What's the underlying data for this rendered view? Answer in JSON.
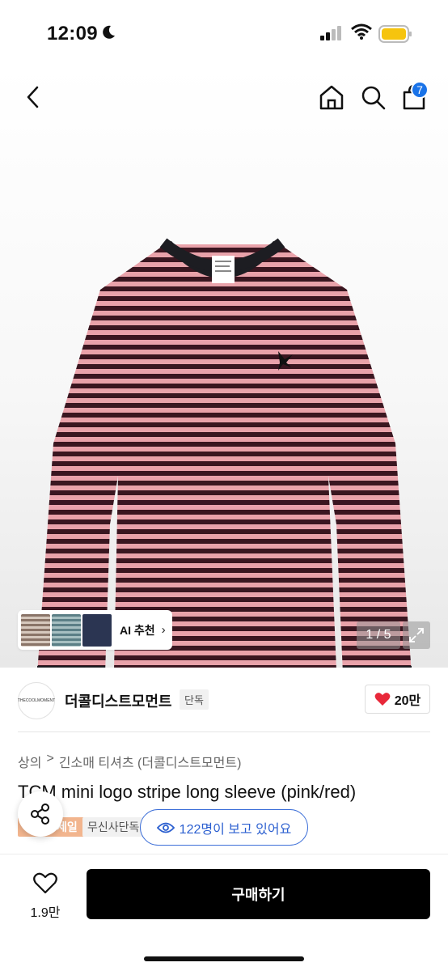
{
  "status": {
    "time": "12:09"
  },
  "nav": {
    "cart_count": "7"
  },
  "hero": {
    "ai_label": "AI 추천",
    "ai_chevron": "›",
    "pager": "1 / 5"
  },
  "brand": {
    "logo_text": "THECOOLMOMENT",
    "name": "더콜디스트모먼트",
    "tag": "단독",
    "likes": "20만"
  },
  "breadcrumb": [
    "상의",
    ">",
    "긴소매 티셔츠 (더콜디스트모먼트)"
  ],
  "product": {
    "title": "TCM mini logo stripe long sleeve (pink/red)",
    "sale_tag": "세일",
    "exclusive_tag": "무신사단독",
    "viewers": "122명이 보고 있어요"
  },
  "bottom": {
    "wish_count": "1.9만",
    "buy_label": "구매하기"
  },
  "colors": {
    "accent": "#1a73e8",
    "stripe_pink": "#e9a2aa",
    "stripe_dark": "#3a1620",
    "buy": "#000000"
  }
}
